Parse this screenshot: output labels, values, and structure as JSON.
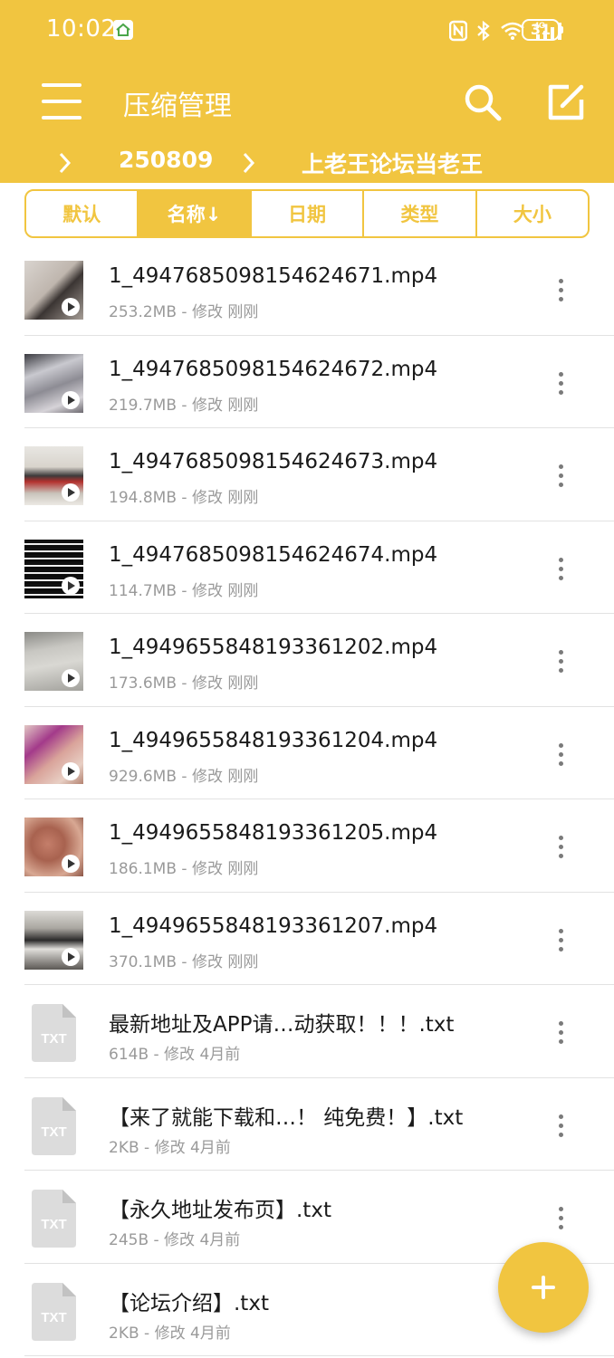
{
  "status_bar": {
    "time": "10:02",
    "battery": "31",
    "icons": [
      "nfc-icon",
      "bluetooth-icon",
      "wifi-icon",
      "4g-signal-icon",
      "battery-icon"
    ]
  },
  "toolbar": {
    "title": "压缩管理",
    "menu_icon": "hamburger-menu-icon",
    "search_icon": "search-icon",
    "edit_icon": "edit-icon"
  },
  "breadcrumb": {
    "items": [
      "250809",
      "上老王论坛当老王"
    ]
  },
  "sort": {
    "tabs": [
      "默认",
      "名称↓",
      "日期",
      "类型",
      "大小"
    ],
    "active_index": 1
  },
  "files": [
    {
      "name": "1_4947685098154624671.mp4",
      "meta": "253.2MB - 修改 刚刚",
      "type": "video"
    },
    {
      "name": "1_4947685098154624672.mp4",
      "meta": "219.7MB - 修改 刚刚",
      "type": "video"
    },
    {
      "name": "1_4947685098154624673.mp4",
      "meta": "194.8MB - 修改 刚刚",
      "type": "video"
    },
    {
      "name": "1_4947685098154624674.mp4",
      "meta": "114.7MB - 修改 刚刚",
      "type": "video"
    },
    {
      "name": "1_4949655848193361202.mp4",
      "meta": "173.6MB - 修改 刚刚",
      "type": "video"
    },
    {
      "name": "1_4949655848193361204.mp4",
      "meta": "929.6MB - 修改 刚刚",
      "type": "video"
    },
    {
      "name": "1_4949655848193361205.mp4",
      "meta": "186.1MB - 修改 刚刚",
      "type": "video"
    },
    {
      "name": "1_4949655848193361207.mp4",
      "meta": "370.1MB - 修改 刚刚",
      "type": "video"
    },
    {
      "name": "最新地址及APP请…动获取！！！.txt",
      "meta": "614B - 修改 4月前",
      "type": "txt"
    },
    {
      "name": "【来了就能下载和…！ 纯免费！】.txt",
      "meta": "2KB - 修改 4月前",
      "type": "txt"
    },
    {
      "name": "【永久地址发布页】.txt",
      "meta": "245B - 修改 4月前",
      "type": "txt"
    },
    {
      "name": "【论坛介绍】.txt",
      "meta": "2KB - 修改 4月前",
      "type": "txt"
    }
  ],
  "txt_icon_label": "TXT",
  "fab_icon": "plus-icon",
  "colors": {
    "accent": "#f1c540",
    "text": "#1a1a1a",
    "meta": "#9a9a9a",
    "divider": "#e2e2e2"
  }
}
